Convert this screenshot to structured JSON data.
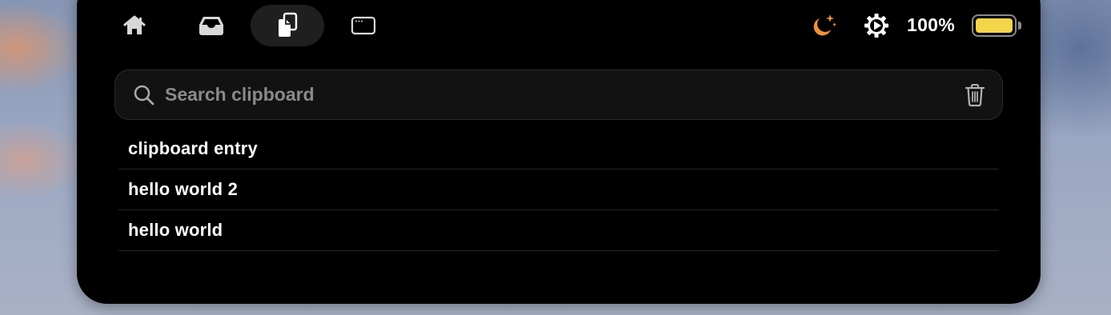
{
  "toolbar": {
    "tabs": [
      {
        "icon": "home-icon",
        "active": false
      },
      {
        "icon": "tray-icon",
        "active": false
      },
      {
        "icon": "clipboard-icon",
        "active": true
      },
      {
        "icon": "window-icon",
        "active": false
      }
    ]
  },
  "status": {
    "night_icon": "moon-stars-icon",
    "settings_icon": "gear-play-icon",
    "battery_percent_label": "100%",
    "battery_level": 1.0,
    "battery_color": "#f5d54a",
    "accent_orange": "#f0913a"
  },
  "search": {
    "placeholder": "Search clipboard",
    "value": "",
    "clear_icon": "trash-icon"
  },
  "clipboard": {
    "items": [
      {
        "text": "clipboard entry"
      },
      {
        "text": "hello world 2"
      },
      {
        "text": "hello world"
      }
    ]
  }
}
